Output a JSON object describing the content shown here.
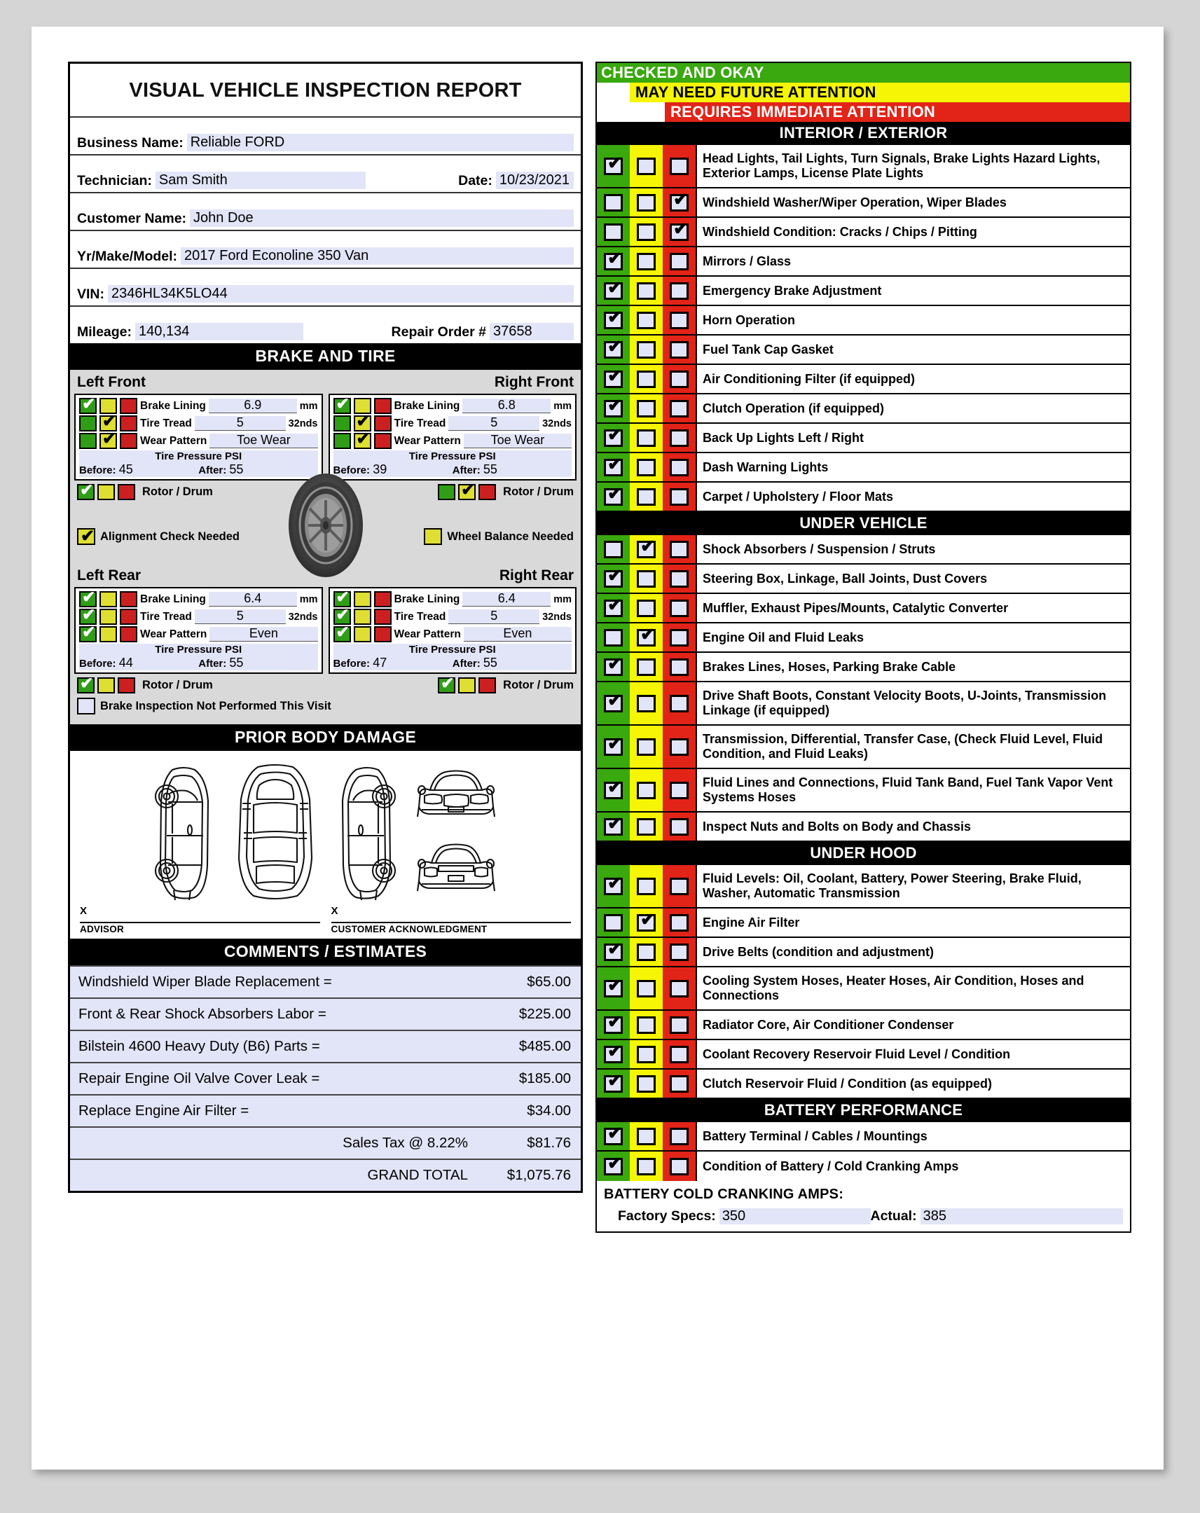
{
  "left": {
    "title": "VISUAL VEHICLE INSPECTION REPORT",
    "fields": [
      {
        "label": "Business Name:",
        "value": "Reliable FORD"
      },
      {
        "label": "Technician:",
        "value": "Sam Smith",
        "label2": "Date:",
        "value2": "10/23/2021"
      },
      {
        "label": "Customer Name:",
        "value": "John Doe"
      },
      {
        "label": "Yr/Make/Model:",
        "value": "2017 Ford Econoline 350 Van"
      },
      {
        "label": "VIN:",
        "value": "2346HL34K5LO44"
      },
      {
        "label": "Mileage:",
        "value": "140,134",
        "label2": "Repair Order #",
        "value2": "37658"
      }
    ],
    "brake_tire_header": "BRAKE AND TIRE",
    "corners": [
      {
        "name": "Left Front",
        "side": "left",
        "rows": [
          {
            "label": "Brake Lining",
            "value": "6.9",
            "unit": "mm",
            "mark": "g"
          },
          {
            "label": "Tire Tread",
            "value": "5",
            "unit": "32nds",
            "mark": "y"
          },
          {
            "label": "Wear Pattern",
            "value": "Toe Wear",
            "unit": "",
            "mark": "y"
          }
        ],
        "psi_label": "Tire Pressure PSI",
        "before_label": "Before:",
        "before": "45",
        "after_label": "After:",
        "after": "55",
        "rotor_label": "Rotor / Drum",
        "rotor_mark": "g"
      },
      {
        "name": "Right Front",
        "side": "right",
        "rows": [
          {
            "label": "Brake Lining",
            "value": "6.8",
            "unit": "mm",
            "mark": "g"
          },
          {
            "label": "Tire Tread",
            "value": "5",
            "unit": "32nds",
            "mark": "y"
          },
          {
            "label": "Wear Pattern",
            "value": "Toe Wear",
            "unit": "",
            "mark": "y"
          }
        ],
        "psi_label": "Tire Pressure PSI",
        "before_label": "Before:",
        "before": "39",
        "after_label": "After:",
        "after": "55",
        "rotor_label": "Rotor / Drum",
        "rotor_mark": "y"
      },
      {
        "name": "Left Rear",
        "side": "left",
        "rows": [
          {
            "label": "Brake Lining",
            "value": "6.4",
            "unit": "mm",
            "mark": "g"
          },
          {
            "label": "Tire Tread",
            "value": "5",
            "unit": "32nds",
            "mark": "g"
          },
          {
            "label": "Wear Pattern",
            "value": "Even",
            "unit": "",
            "mark": "g"
          }
        ],
        "psi_label": "Tire Pressure PSI",
        "before_label": "Before:",
        "before": "44",
        "after_label": "After:",
        "after": "55",
        "rotor_label": "Rotor / Drum",
        "rotor_mark": "g"
      },
      {
        "name": "Right Rear",
        "side": "right",
        "rows": [
          {
            "label": "Brake Lining",
            "value": "6.4",
            "unit": "mm",
            "mark": "g"
          },
          {
            "label": "Tire Tread",
            "value": "5",
            "unit": "32nds",
            "mark": "g"
          },
          {
            "label": "Wear Pattern",
            "value": "Even",
            "unit": "",
            "mark": "g"
          }
        ],
        "psi_label": "Tire Pressure PSI",
        "before_label": "Before:",
        "before": "47",
        "after_label": "After:",
        "after": "55",
        "rotor_label": "Rotor / Drum",
        "rotor_mark": "g"
      }
    ],
    "alignment_label": "Alignment Check Needed",
    "alignment_checked": true,
    "wheel_balance_label": "Wheel Balance Needed",
    "wheel_balance_checked": false,
    "not_performed_label": "Brake Inspection Not Performed This Visit",
    "not_performed_checked": false,
    "body_damage_header": "PRIOR BODY DAMAGE",
    "sig_x": "X",
    "sig_advisor": "ADVISOR",
    "sig_customer": "CUSTOMER ACKNOWLEDGMENT",
    "comments_header": "COMMENTS / ESTIMATES",
    "estimates": [
      {
        "name": "Windshield Wiper Blade Replacement =",
        "amount": "$65.00",
        "align": "left"
      },
      {
        "name": "Front & Rear Shock Absorbers Labor =",
        "amount": "$225.00",
        "align": "left"
      },
      {
        "name": "Bilstein 4600 Heavy Duty (B6) Parts =",
        "amount": "$485.00",
        "align": "left"
      },
      {
        "name": "Repair Engine Oil Valve Cover Leak =",
        "amount": "$185.00",
        "align": "left"
      },
      {
        "name": "Replace Engine Air Filter =",
        "amount": "$34.00",
        "align": "left"
      },
      {
        "name": "Sales Tax  @  8.22%",
        "amount": "$81.76",
        "align": "right"
      },
      {
        "name": "GRAND  TOTAL",
        "amount": "$1,075.76",
        "align": "right"
      }
    ]
  },
  "right": {
    "legend": {
      "ok": "CHECKED AND OKAY",
      "future": "MAY NEED FUTURE ATTENTION",
      "immediate": "REQUIRES IMMEDIATE ATTENTION"
    },
    "sections": [
      {
        "header": "INTERIOR / EXTERIOR",
        "items": [
          {
            "label": "Head Lights, Tail Lights, Turn Signals, Brake Lights Hazard Lights, Exterior Lamps, License Plate Lights",
            "status": "g",
            "lines": 2
          },
          {
            "label": "Windshield Washer/Wiper Operation, Wiper Blades",
            "status": "r",
            "lines": 1
          },
          {
            "label": "Windshield Condition: Cracks / Chips / Pitting",
            "status": "r",
            "lines": 1
          },
          {
            "label": "Mirrors / Glass",
            "status": "g",
            "lines": 1
          },
          {
            "label": "Emergency Brake Adjustment",
            "status": "g",
            "lines": 1
          },
          {
            "label": "Horn Operation",
            "status": "g",
            "lines": 1
          },
          {
            "label": "Fuel Tank Cap Gasket",
            "status": "g",
            "lines": 1
          },
          {
            "label": "Air Conditioning Filter (if equipped)",
            "status": "g",
            "lines": 1
          },
          {
            "label": "Clutch Operation (if equipped)",
            "status": "g",
            "lines": 1
          },
          {
            "label": "Back Up Lights Left / Right",
            "status": "g",
            "lines": 1
          },
          {
            "label": "Dash Warning Lights",
            "status": "g",
            "lines": 1
          },
          {
            "label": "Carpet / Upholstery / Floor Mats",
            "status": "g",
            "lines": 1
          }
        ]
      },
      {
        "header": "UNDER VEHICLE",
        "items": [
          {
            "label": "Shock Absorbers / Suspension / Struts",
            "status": "y",
            "lines": 1
          },
          {
            "label": "Steering Box, Linkage, Ball Joints, Dust Covers",
            "status": "g",
            "lines": 1
          },
          {
            "label": "Muffler, Exhaust Pipes/Mounts, Catalytic Converter",
            "status": "g",
            "lines": 1
          },
          {
            "label": "Engine Oil and Fluid Leaks",
            "status": "y",
            "lines": 1
          },
          {
            "label": "Brakes Lines, Hoses, Parking Brake Cable",
            "status": "g",
            "lines": 1
          },
          {
            "label": "Drive Shaft Boots, Constant Velocity Boots, U-Joints,  Transmission Linkage (if equipped)",
            "status": "g",
            "lines": 2
          },
          {
            "label": "Transmission, Differential, Transfer Case, (Check Fluid Level, Fluid Condition, and Fluid Leaks)",
            "status": "g",
            "lines": 2
          },
          {
            "label": "Fluid Lines and Connections, Fluid Tank Band, Fuel Tank Vapor Vent Systems Hoses",
            "status": "g",
            "lines": 2
          },
          {
            "label": "Inspect Nuts and Bolts on Body and Chassis",
            "status": "g",
            "lines": 1
          }
        ]
      },
      {
        "header": "UNDER HOOD",
        "items": [
          {
            "label": "Fluid Levels: Oil, Coolant, Battery, Power Steering, Brake Fluid, Washer, Automatic Transmission",
            "status": "g",
            "lines": 2
          },
          {
            "label": "Engine Air Filter",
            "status": "y",
            "lines": 1
          },
          {
            "label": "Drive Belts (condition and adjustment)",
            "status": "g",
            "lines": 1
          },
          {
            "label": "Cooling System Hoses, Heater Hoses, Air Condition, Hoses and Connections",
            "status": "g",
            "lines": 2
          },
          {
            "label": "Radiator Core, Air Conditioner Condenser",
            "status": "g",
            "lines": 1
          },
          {
            "label": "Coolant Recovery Reservoir Fluid Level / Condition",
            "status": "g",
            "lines": 1
          },
          {
            "label": "Clutch Reservoir Fluid / Condition (as equipped)",
            "status": "g",
            "lines": 1
          }
        ]
      },
      {
        "header": "BATTERY PERFORMANCE",
        "items": [
          {
            "label": "Battery Terminal / Cables / Mountings",
            "status": "g",
            "lines": 1
          },
          {
            "label": "Condition of Battery / Cold Cranking Amps",
            "status": "g",
            "lines": 1
          }
        ]
      }
    ],
    "cca": {
      "title": "BATTERY COLD CRANKING AMPS:",
      "factory_label": "Factory Specs:",
      "factory_value": "350",
      "actual_label": "Actual:",
      "actual_value": "385"
    }
  },
  "icons": {
    "check": "✔"
  }
}
